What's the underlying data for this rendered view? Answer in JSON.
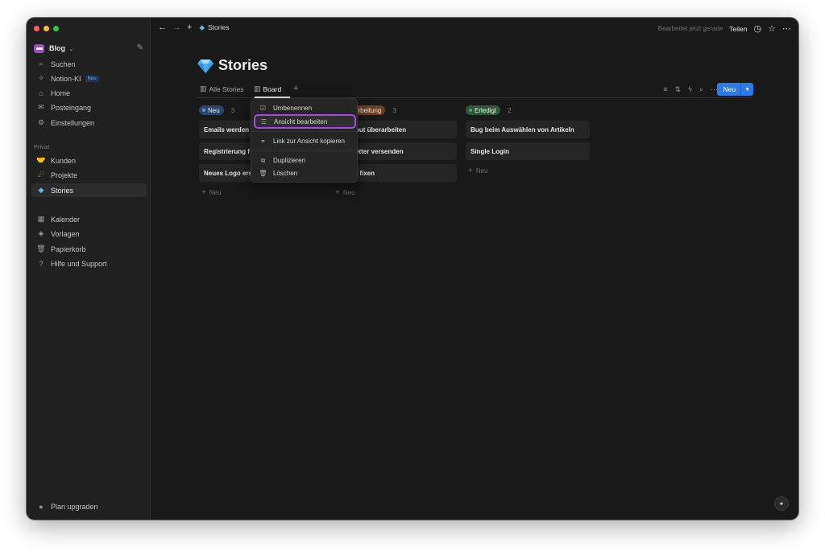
{
  "sidebar": {
    "workspace": "Blog",
    "nav": [
      {
        "icon": "search-icon",
        "label": "Suchen"
      },
      {
        "icon": "sparkle-icon",
        "label": "Notion-KI",
        "badge": "Neu"
      },
      {
        "icon": "home-icon",
        "label": "Home"
      },
      {
        "icon": "inbox-icon",
        "label": "Posteingang"
      },
      {
        "icon": "gear-icon",
        "label": "Einstellungen"
      }
    ],
    "section_label": "Privat",
    "pages": [
      {
        "icon": "handshake-icon",
        "label": "Kunden"
      },
      {
        "icon": "comet-icon",
        "label": "Projekte"
      },
      {
        "icon": "gem-icon",
        "label": "Stories"
      }
    ],
    "bottom": [
      {
        "icon": "calendar-icon",
        "label": "Kalender"
      },
      {
        "icon": "shapes-icon",
        "label": "Vorlagen"
      },
      {
        "icon": "trash-icon",
        "label": "Papierkorb"
      },
      {
        "icon": "help-icon",
        "label": "Hilfe und Support"
      }
    ],
    "upgrade": "Plan upgraden"
  },
  "topbar": {
    "breadcrumb": "Stories",
    "edited": "Bearbeitet jetzt gerade",
    "share": "Teilen"
  },
  "page": {
    "title": "Stories",
    "tabs": [
      "Alle Stories",
      "Board"
    ],
    "new_button": "Neu"
  },
  "board": {
    "columns": [
      {
        "status": "Neu",
        "count": "3",
        "color": "#28456c",
        "cards": [
          "Emails werden",
          "Registrierung f",
          "Neues Logo ers"
        ],
        "add": "Neu"
      },
      {
        "status": "arbeitung",
        "count": "3",
        "color": "#6b4022",
        "cards": [
          "out überarbeiten",
          "etter versenden",
          "r fixen"
        ],
        "add": "Neu"
      },
      {
        "status": "Erledigt",
        "count": "2",
        "color": "#2b5938",
        "cards": [
          "Bug beim Auswählen von Artikeln",
          "Single Login"
        ],
        "add": "Neu"
      }
    ]
  },
  "menu": {
    "items": [
      {
        "icon": "rename-icon",
        "label": "Umbenennen"
      },
      {
        "icon": "sliders-icon",
        "label": "Ansicht bearbeiten"
      },
      {
        "icon": "link-icon",
        "label": "Link zur Ansicht kopieren"
      },
      {
        "icon": "duplicate-icon",
        "label": "Duplizieren"
      },
      {
        "icon": "trash-icon",
        "label": "Löschen"
      }
    ],
    "highlight_color": "#a64ad9"
  },
  "colors": {
    "accent": "#2d7ae5",
    "background": "#191919",
    "sidebar": "#202020"
  }
}
